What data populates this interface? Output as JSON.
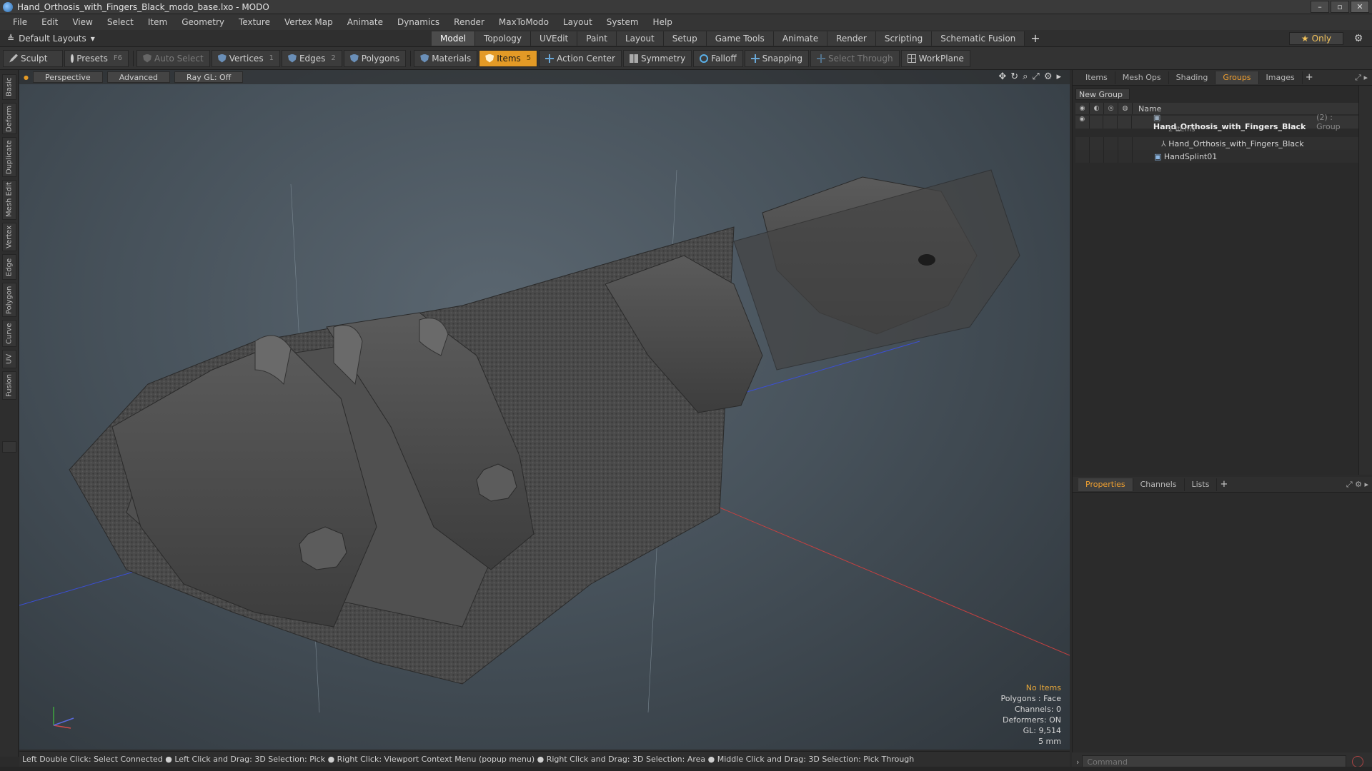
{
  "window": {
    "title": "Hand_Orthosis_with_Fingers_Black_modo_base.lxo - MODO",
    "controls": [
      "–",
      "▫",
      "✕"
    ]
  },
  "menu": [
    "File",
    "Edit",
    "View",
    "Select",
    "Item",
    "Geometry",
    "Texture",
    "Vertex Map",
    "Animate",
    "Dynamics",
    "Render",
    "MaxToModo",
    "Layout",
    "System",
    "Help"
  ],
  "layout": {
    "selector": "Default Layouts",
    "tabs": [
      "Model",
      "Topology",
      "UVEdit",
      "Paint",
      "Layout",
      "Setup",
      "Game Tools",
      "Animate",
      "Render",
      "Scripting",
      "Schematic Fusion"
    ],
    "active_tab": "Model",
    "only_label": "Only"
  },
  "toolbar": {
    "sculpt": "Sculpt",
    "presets": "Presets",
    "presets_key": "F6",
    "auto_select": "Auto Select",
    "vertices": "Vertices",
    "vertices_key": "1",
    "edges": "Edges",
    "edges_key": "2",
    "polygons": "Polygons",
    "materials": "Materials",
    "items": "Items",
    "items_key": "5",
    "action_center": "Action Center",
    "symmetry": "Symmetry",
    "falloff": "Falloff",
    "snapping": "Snapping",
    "select_through": "Select Through",
    "workplane": "WorkPlane"
  },
  "left_tabs": [
    "Basic",
    "Deform",
    "Duplicate",
    "Mesh Edit",
    "Vertex",
    "Edge",
    "Polygon",
    "Curve",
    "UV",
    "Fusion"
  ],
  "viewport": {
    "view_mode": "Perspective",
    "shading": "Advanced",
    "raygl": "Ray GL: Off",
    "info": {
      "no_items": "No Items",
      "polygons": "Polygons : Face",
      "channels": "Channels: 0",
      "deformers": "Deformers: ON",
      "gl": "GL: 9,514",
      "scale": "5 mm"
    }
  },
  "groups_panel": {
    "tabs": [
      "Items",
      "Mesh Ops",
      "Shading",
      "Groups",
      "Images"
    ],
    "active_tab": "Groups",
    "new_group": "New Group",
    "name_header": "Name",
    "root": {
      "name": "Hand_Orthosis_with_Fingers_Black",
      "meta": "(2) : Group",
      "count": "2 Items"
    },
    "children": [
      "Hand_Orthosis_with_Fingers_Black",
      "HandSplint01"
    ]
  },
  "properties_panel": {
    "tabs": [
      "Properties",
      "Channels",
      "Lists"
    ],
    "active_tab": "Properties"
  },
  "command": {
    "placeholder": "Command"
  },
  "status": {
    "hint": "Left Double Click: Select Connected ● Left Click and Drag: 3D Selection: Pick ● Right Click: Viewport Context Menu (popup menu) ● Right Click and Drag: 3D Selection: Area ● Middle Click and Drag: 3D Selection: Pick Through"
  },
  "colors": {
    "accent": "#e39a26",
    "active_tab_text": "#f0a030"
  }
}
